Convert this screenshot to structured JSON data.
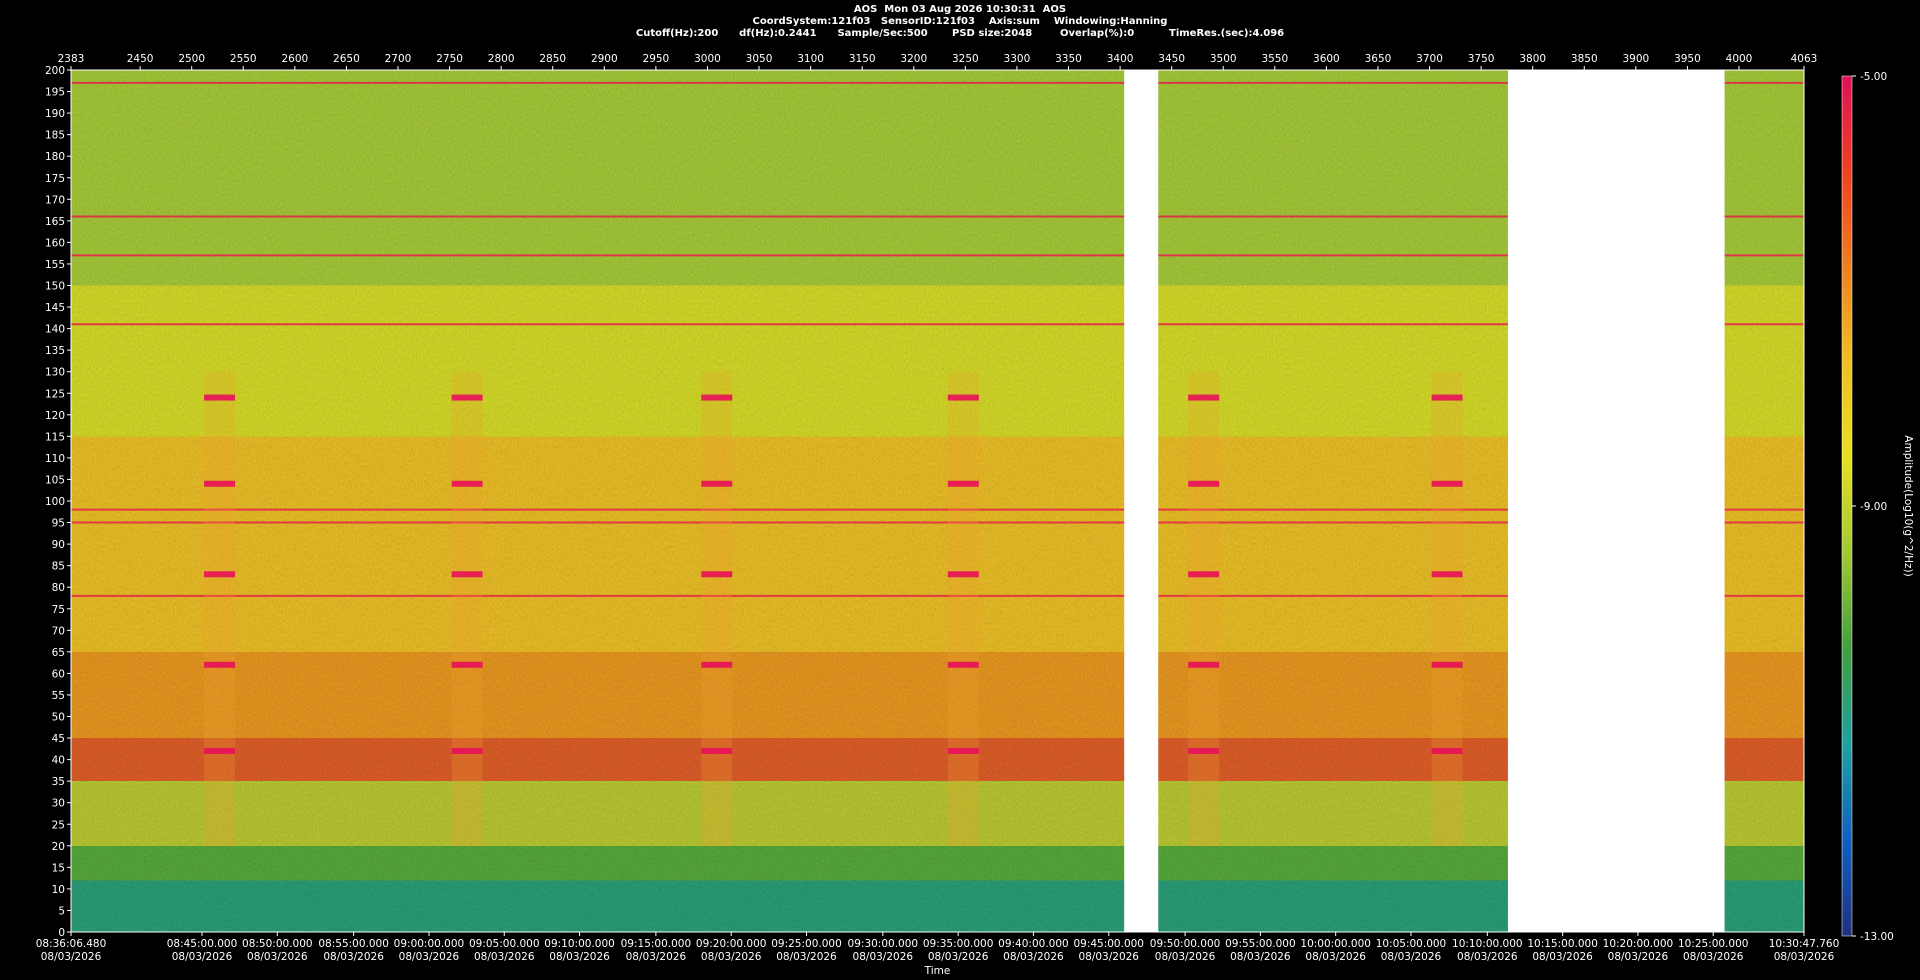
{
  "header": {
    "line1": "AOS  Mon 03 Aug 2026 10:30:31  AOS",
    "line2": "CoordSystem:121f03   SensorID:121f03    Axis:sum    Windowing:Hanning",
    "line3": "Cutoff(Hz):200      df(Hz):0.2441      Sample/Sec:500       PSD size:2048        Overlap(%):0          TimeRes.(sec):4.096"
  },
  "chart_data": {
    "type": "heatmap",
    "title": "",
    "xlabel": "Time",
    "ylabel": "",
    "colorbar_label": "Amplitude(Log10(g^2/Hz))",
    "ylim": [
      0,
      200
    ],
    "x_index_range": [
      2383,
      4063
    ],
    "y_ticks": [
      200,
      195,
      190,
      185,
      180,
      175,
      170,
      165,
      160,
      155,
      150,
      145,
      140,
      135,
      130,
      125,
      120,
      115,
      110,
      105,
      100,
      95,
      90,
      85,
      80,
      75,
      70,
      65,
      60,
      55,
      50,
      45,
      40,
      35,
      30,
      25,
      20,
      15,
      10,
      5,
      0
    ],
    "top_ticks": [
      "2383",
      "2450",
      "2500",
      "2550",
      "2600",
      "2650",
      "2700",
      "2750",
      "2800",
      "2850",
      "2900",
      "2950",
      "3000",
      "3050",
      "3100",
      "3150",
      "3200",
      "3250",
      "3300",
      "3350",
      "3400",
      "3450",
      "3500",
      "3550",
      "3600",
      "3650",
      "3700",
      "3750",
      "3800",
      "3850",
      "3900",
      "3950",
      "4000",
      "4063"
    ],
    "bottom_ticks": [
      {
        "index": 2383,
        "time": "08:36:06.480",
        "date": "08/03/2026"
      },
      {
        "index": 2510,
        "time": "08:45:00.000",
        "date": "08/03/2026"
      },
      {
        "index": 2583,
        "time": "08:50:00.000",
        "date": "08/03/2026"
      },
      {
        "index": 2657,
        "time": "08:55:00.000",
        "date": "08/03/2026"
      },
      {
        "index": 2730,
        "time": "09:00:00.000",
        "date": "08/03/2026"
      },
      {
        "index": 2803,
        "time": "09:05:00.000",
        "date": "08/03/2026"
      },
      {
        "index": 2876,
        "time": "09:10:00.000",
        "date": "08/03/2026"
      },
      {
        "index": 2950,
        "time": "09:15:00.000",
        "date": "08/03/2026"
      },
      {
        "index": 3023,
        "time": "09:20:00.000",
        "date": "08/03/2026"
      },
      {
        "index": 3096,
        "time": "09:25:00.000",
        "date": "08/03/2026"
      },
      {
        "index": 3170,
        "time": "09:30:00.000",
        "date": "08/03/2026"
      },
      {
        "index": 3243,
        "time": "09:35:00.000",
        "date": "08/03/2026"
      },
      {
        "index": 3316,
        "time": "09:40:00.000",
        "date": "08/03/2026"
      },
      {
        "index": 3389,
        "time": "09:45:00.000",
        "date": "08/03/2026"
      },
      {
        "index": 3463,
        "time": "09:50:00.000",
        "date": "08/03/2026"
      },
      {
        "index": 3536,
        "time": "09:55:00.000",
        "date": "08/03/2026"
      },
      {
        "index": 3609,
        "time": "10:00:00.000",
        "date": "08/03/2026"
      },
      {
        "index": 3682,
        "time": "10:05:00.000",
        "date": "08/03/2026"
      },
      {
        "index": 3756,
        "time": "10:10:00.000",
        "date": "08/03/2026"
      },
      {
        "index": 3829,
        "time": "10:15:00.000",
        "date": "08/03/2026"
      },
      {
        "index": 3902,
        "time": "10:20:00.000",
        "date": "08/03/2026"
      },
      {
        "index": 3975,
        "time": "10:25:00.000",
        "date": "08/03/2026"
      },
      {
        "index": 4063,
        "time": "10:30:47.760",
        "date": "08/03/2026"
      }
    ],
    "colorbar": {
      "max": -5.0,
      "mid": -9.0,
      "min": -13.0,
      "max_label": "-5.00",
      "mid_label": "-9.00",
      "min_label": "-13.00",
      "colors": [
        "#e0105a",
        "#f04020",
        "#f08020",
        "#f0c020",
        "#e8e020",
        "#a0c830",
        "#40a040",
        "#20a0a0",
        "#1060c0",
        "#203080"
      ]
    },
    "data_gaps_index": [
      [
        3404,
        3437
      ],
      [
        3776,
        3986
      ]
    ],
    "persistent_lines_hz": [
      197,
      141,
      98,
      95,
      78,
      157,
      166
    ],
    "periodic_bursts": {
      "start_indices": [
        2512,
        2752,
        2994,
        3233,
        3466,
        3702
      ],
      "width_index": 30,
      "frequencies_hz": [
        124,
        83,
        62,
        42,
        104
      ]
    },
    "bands": [
      {
        "from_hz": 200,
        "to_hz": 150,
        "level": "green-yellow"
      },
      {
        "from_hz": 150,
        "to_hz": 115,
        "level": "yellow"
      },
      {
        "from_hz": 115,
        "to_hz": 65,
        "level": "yellow-orange"
      },
      {
        "from_hz": 65,
        "to_hz": 45,
        "level": "orange"
      },
      {
        "from_hz": 45,
        "to_hz": 35,
        "level": "red-orange"
      },
      {
        "from_hz": 35,
        "to_hz": 20,
        "level": "yellow-green"
      },
      {
        "from_hz": 20,
        "to_hz": 12,
        "level": "green"
      },
      {
        "from_hz": 12,
        "to_hz": 0,
        "level": "teal-green"
      }
    ]
  }
}
